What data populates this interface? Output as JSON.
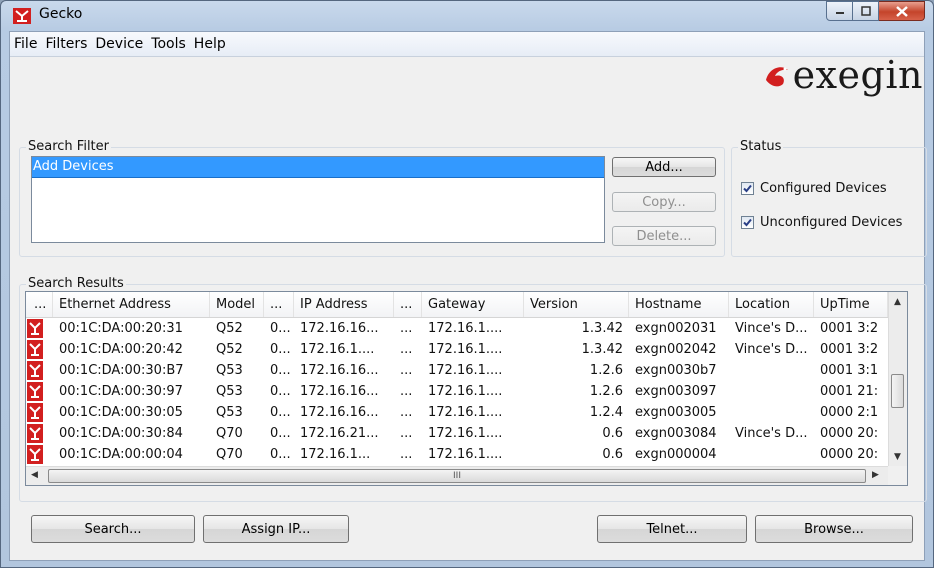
{
  "window": {
    "title": "Gecko"
  },
  "menu": [
    "File",
    "Filters",
    "Device",
    "Tools",
    "Help"
  ],
  "logo": {
    "text": "exegin"
  },
  "search_filter": {
    "label": "Search Filter",
    "items": [
      "Add Devices"
    ],
    "buttons": {
      "add": "Add...",
      "copy": "Copy...",
      "delete": "Delete..."
    }
  },
  "status": {
    "label": "Status",
    "configured": "Configured Devices",
    "unconfigured": "Unconfigured Devices"
  },
  "results": {
    "label": "Search Results",
    "columns": [
      "...",
      "Ethernet Address",
      "Model",
      "...",
      "IP Address",
      "...",
      "Gateway",
      "Version",
      "Hostname",
      "Location",
      "UpTime"
    ],
    "rows": [
      [
        "00:1C:DA:00:20:31",
        "Q52",
        "0...",
        "172.16.16...",
        "...",
        "172.16.1....",
        "1.3.42",
        "exgn002031",
        "Vince's D...",
        "0001 3:2"
      ],
      [
        "00:1C:DA:00:20:42",
        "Q52",
        "0...",
        "172.16.1....",
        "...",
        "172.16.1....",
        "1.3.42",
        "exgn002042",
        "Vince's D...",
        "0001 3:2"
      ],
      [
        "00:1C:DA:00:30:B7",
        "Q53",
        "0...",
        "172.16.16...",
        "...",
        "172.16.1....",
        "1.2.6",
        "exgn0030b7",
        "",
        "0001 3:1"
      ],
      [
        "00:1C:DA:00:30:97",
        "Q53",
        "0...",
        "172.16.16...",
        "...",
        "172.16.1....",
        "1.2.6",
        "exgn003097",
        "",
        "0001 21:"
      ],
      [
        "00:1C:DA:00:30:05",
        "Q53",
        "0...",
        "172.16.16...",
        "...",
        "172.16.1....",
        "1.2.4",
        "exgn003005",
        "",
        "0000 2:1"
      ],
      [
        "00:1C:DA:00:30:84",
        "Q70",
        "0...",
        "172.16.21...",
        "...",
        "172.16.1....",
        "0.6",
        "exgn003084",
        "Vince's D...",
        "0000 20:"
      ],
      [
        "00:1C:DA:00:00:04",
        "Q70",
        "0...",
        "172.16.1...",
        "...",
        "172.16.1....",
        "0.6",
        "exgn000004",
        "",
        "0000 20:"
      ]
    ],
    "hscroll_grip": "III"
  },
  "buttons": {
    "search": "Search...",
    "assign_ip": "Assign IP...",
    "telnet": "Telnet...",
    "browse": "Browse..."
  },
  "colors": {
    "selection": "#3399ff",
    "logo_red": "#d21f1f",
    "title_bar": "#c9d9ec"
  }
}
